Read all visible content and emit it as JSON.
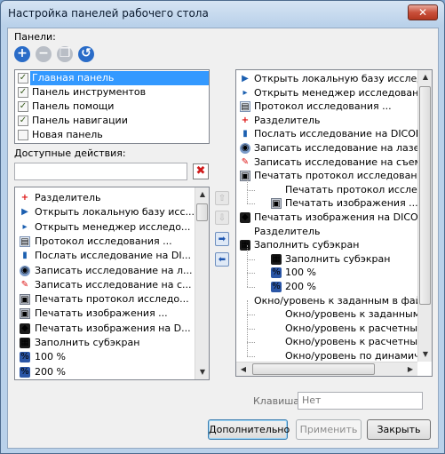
{
  "window": {
    "title": "Настройка панелей рабочего стола",
    "close_glyph": "✕"
  },
  "panels_label": "Панели:",
  "toolbar": [
    {
      "icon": "add-icon",
      "glyph": "+",
      "color": "#2a6cc8"
    },
    {
      "icon": "remove-icon",
      "glyph": "−",
      "color": "#b9bec6"
    },
    {
      "icon": "copy-icon",
      "glyph": "❐",
      "color": "#b9bec6"
    },
    {
      "icon": "rename-icon",
      "glyph": "↺",
      "color": "#2a6cc8"
    }
  ],
  "panels": [
    {
      "label": "Главная панель",
      "checked": true,
      "selected": true
    },
    {
      "label": "Панель инструментов",
      "checked": true,
      "selected": false
    },
    {
      "label": "Панель помощи",
      "checked": true,
      "selected": false
    },
    {
      "label": "Панель навигации",
      "checked": true,
      "selected": false
    },
    {
      "label": "Новая панель",
      "checked": false,
      "selected": false
    }
  ],
  "available_label": "Доступные действия:",
  "search": {
    "value": "",
    "placeholder": ""
  },
  "clear_glyph": "✖",
  "available_actions": [
    {
      "label": "Разделитель",
      "icon": "separator-icon"
    },
    {
      "label": "Открыть локальную базу исс...",
      "icon": "open-db-icon"
    },
    {
      "label": "Открыть менеджер исследо...",
      "icon": "manager-icon"
    },
    {
      "label": "Протокол исследования ...",
      "icon": "protocol-icon"
    },
    {
      "label": "Послать исследование на DI...",
      "icon": "send-dicom-icon"
    },
    {
      "label": "Записать исследование на л...",
      "icon": "burn-disc-icon"
    },
    {
      "label": "Записать исследование на с...",
      "icon": "write-removable-icon"
    },
    {
      "label": "Печатать протокол исследо...",
      "icon": "print-protocol-icon"
    },
    {
      "label": "Печатать изображения ...",
      "icon": "print-images-icon"
    },
    {
      "label": "Печатать изображения на D...",
      "icon": "print-dicom-icon"
    },
    {
      "label": "Заполнить субэкран",
      "icon": "fill-subscreen-icon"
    },
    {
      "label": "100 %",
      "icon": "zoom-100-icon"
    },
    {
      "label": "200 %",
      "icon": "zoom-200-icon"
    }
  ],
  "move_buttons": [
    {
      "icon": "move-up-icon",
      "glyph": "⇧",
      "enabled": false
    },
    {
      "icon": "move-down-icon",
      "glyph": "⇩",
      "enabled": false
    },
    {
      "icon": "add-to-panel-icon",
      "glyph": "➡",
      "enabled": true
    },
    {
      "icon": "remove-from-panel-icon",
      "glyph": "⬅",
      "enabled": true
    }
  ],
  "panel_items": [
    {
      "label": "Открыть локальную базу исследова",
      "icon": "open-db-icon",
      "level": 0
    },
    {
      "label": "Открыть менеджер исследований ...",
      "icon": "manager-icon",
      "level": 0
    },
    {
      "label": "Протокол исследования ...",
      "icon": "protocol-icon",
      "level": 0
    },
    {
      "label": "Разделитель",
      "icon": "separator-icon",
      "level": 0
    },
    {
      "label": "Послать исследование на DICOM узел",
      "icon": "send-dicom-icon",
      "level": 0
    },
    {
      "label": "Записать исследование на лазерный",
      "icon": "burn-disc-icon",
      "level": 0
    },
    {
      "label": "Записать исследование на съемный",
      "icon": "write-removable-icon",
      "level": 0
    },
    {
      "label": "Печатать протокол исследования ...",
      "icon": "print-protocol-icon",
      "level": 0
    },
    {
      "label": "Печатать протокол исследов",
      "icon": "",
      "level": 1
    },
    {
      "label": "Печатать изображения ...",
      "icon": "print-images-icon",
      "level": 1
    },
    {
      "label": "Печатать изображения на DICOM пр",
      "icon": "print-dicom-icon",
      "level": 0
    },
    {
      "label": "Разделитель",
      "icon": "",
      "level": 0
    },
    {
      "label": "Заполнить субэкран",
      "icon": "fill-subscreen-icon",
      "level": 0
    },
    {
      "label": "Заполнить субэкран",
      "icon": "fill-subscreen-icon",
      "level": 1
    },
    {
      "label": "100 %",
      "icon": "zoom-100-icon",
      "level": 1
    },
    {
      "label": "200 %",
      "icon": "zoom-200-icon",
      "level": 1
    },
    {
      "label": "Окно/уровень к заданным в файле",
      "icon": "",
      "level": 0
    },
    {
      "label": "Окно/уровень к заданным в ф",
      "icon": "",
      "level": 1
    },
    {
      "label": "Окно/уровень к расчетным з",
      "icon": "",
      "level": 1
    },
    {
      "label": "Окно/уровень к расчетным п",
      "icon": "",
      "level": 1
    },
    {
      "label": "Окно/уровень по динамическ",
      "icon": "",
      "level": 1
    }
  ],
  "hotkey": {
    "label": "Клавиша:",
    "value": "Нет"
  },
  "buttons": {
    "advanced": "Дополнительно",
    "apply": "Применить",
    "close": "Закрыть"
  },
  "scroll_glyphs": {
    "up": "▲",
    "down": "▼",
    "left": "◀",
    "right": "▶"
  },
  "icon_glyphs": {
    "separator-icon": "+",
    "open-db-icon": "▶",
    "manager-icon": "▸",
    "protocol-icon": "▤",
    "send-dicom-icon": "▮",
    "burn-disc-icon": "◉",
    "write-removable-icon": "✎",
    "print-protocol-icon": "▣",
    "print-images-icon": "▣",
    "print-dicom-icon": "◆",
    "fill-subscreen-icon": "▦",
    "zoom-100-icon": "%",
    "zoom-200-icon": "%"
  },
  "colors": {
    "selection": "#3399ff",
    "title_bar": "#b9d1ea",
    "close_red": "#c9503b"
  }
}
